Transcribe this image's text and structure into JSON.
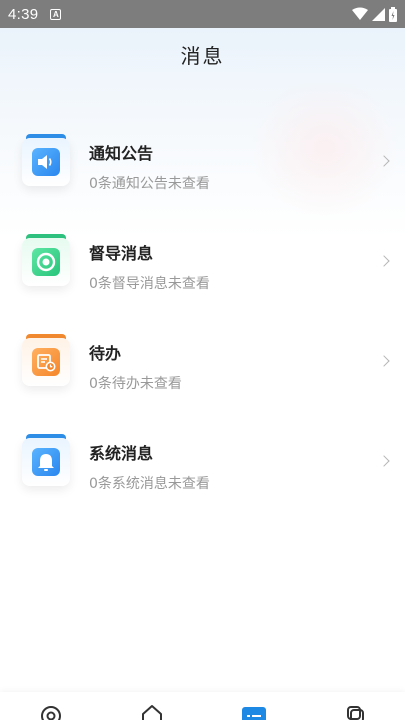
{
  "status_bar": {
    "time": "4:39",
    "notification_letter": "A"
  },
  "page": {
    "title": "消息"
  },
  "items": [
    {
      "title": "通知公告",
      "subtitle": "0条通知公告未查看",
      "icon": "speaker-icon",
      "color": "#3a9cf5"
    },
    {
      "title": "督导消息",
      "subtitle": "0条督导消息未查看",
      "icon": "target-icon",
      "color": "#2fd08a"
    },
    {
      "title": "待办",
      "subtitle": "0条待办未查看",
      "icon": "todo-clock-icon",
      "color": "#f5923a"
    },
    {
      "title": "系统消息",
      "subtitle": "0条系统消息未查看",
      "icon": "bell-icon",
      "color": "#3a9cf5"
    }
  ],
  "tabbar": {
    "tabs": [
      "target-tab-icon",
      "home-icon",
      "messages-icon",
      "profile-icon"
    ],
    "active_index": 2,
    "active_color": "#1e88e5"
  }
}
